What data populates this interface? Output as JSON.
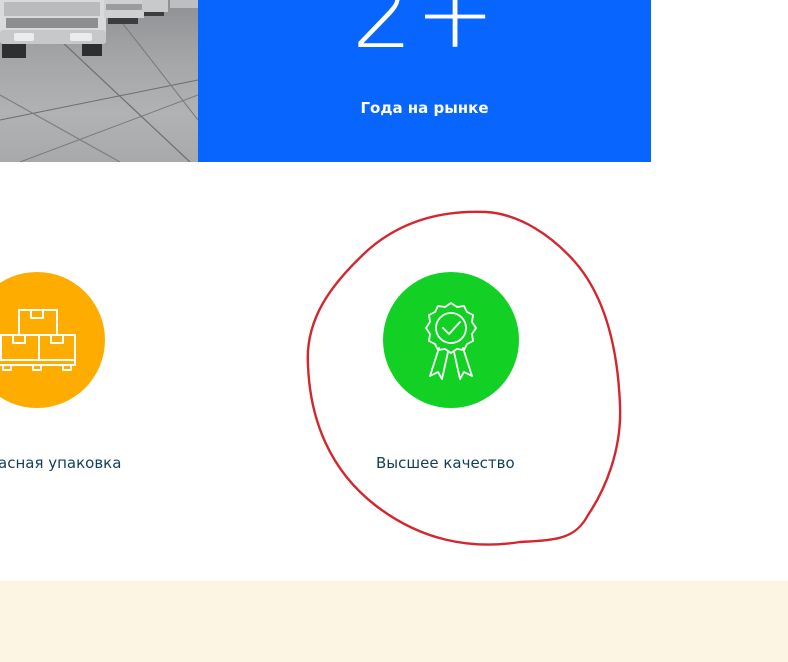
{
  "stat": {
    "number": "2+",
    "label": "Года на рынке"
  },
  "features": [
    {
      "label": "асная упаковка",
      "icon": "boxes-pallet-icon",
      "color": "#ffac00"
    },
    {
      "label": "Высшее качество",
      "icon": "quality-badge-icon",
      "color": "#12d024"
    }
  ],
  "colors": {
    "stat_background": "#0866ff",
    "annotation": "#d4262f",
    "bottom_band": "#fdf5e4",
    "feature_text": "#123f5a"
  }
}
